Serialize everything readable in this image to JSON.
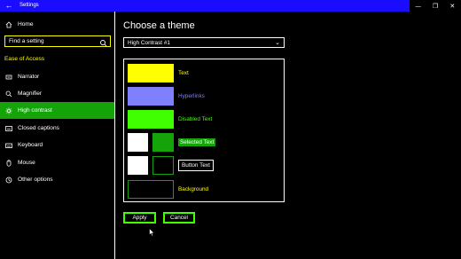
{
  "window": {
    "title": "Settings",
    "back_glyph": "←",
    "minimize_glyph": "—",
    "maximize_glyph": "❐",
    "close_glyph": "✕"
  },
  "sidebar": {
    "home_label": "Home",
    "search_placeholder": "Find a setting",
    "section_label": "Ease of Access",
    "items": [
      {
        "label": "Narrator",
        "icon": "narrator-icon"
      },
      {
        "label": "Magnifier",
        "icon": "magnifier-icon"
      },
      {
        "label": "High contrast",
        "icon": "high-contrast-icon"
      },
      {
        "label": "Closed captions",
        "icon": "closed-captions-icon"
      },
      {
        "label": "Keyboard",
        "icon": "keyboard-icon"
      },
      {
        "label": "Mouse",
        "icon": "mouse-icon"
      },
      {
        "label": "Other options",
        "icon": "other-options-icon"
      }
    ],
    "active_index": 2
  },
  "main": {
    "heading": "Choose a theme",
    "theme_select_value": "High Contrast #1",
    "preview": {
      "text_label": "Text",
      "hyperlinks_label": "Hyperlinks",
      "disabled_text_label": "Disabled Text",
      "selected_text_label": "Selected Text",
      "button_text_label": "Button Text",
      "background_label": "Background"
    },
    "apply_label": "Apply",
    "cancel_label": "Cancel"
  },
  "colors": {
    "title_bar": "#1a0dff",
    "text": "#ffff00",
    "hyperlink": "#8080ff",
    "disabled_text": "#3fff00",
    "selected_bg": "#14a40a",
    "button_border": "#3fff00",
    "background_border": "#14a40a"
  }
}
